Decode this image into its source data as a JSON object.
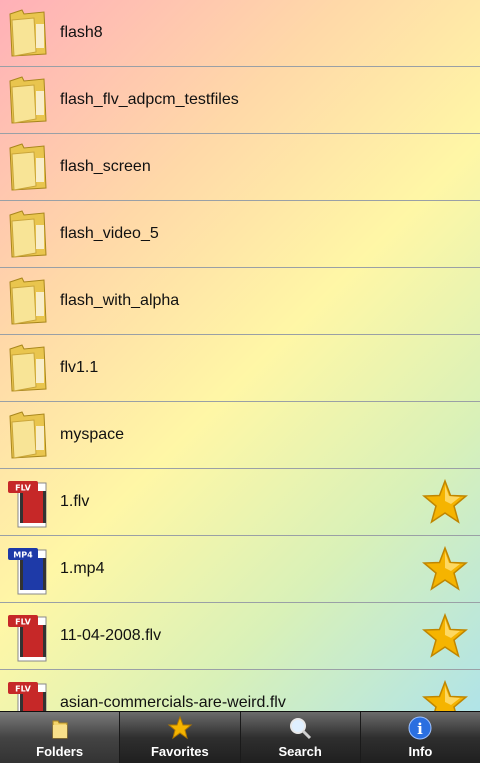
{
  "files": [
    {
      "name": "flash8",
      "type": "folder"
    },
    {
      "name": "flash_flv_adpcm_testfiles",
      "type": "folder"
    },
    {
      "name": "flash_screen",
      "type": "folder"
    },
    {
      "name": "flash_video_5",
      "type": "folder"
    },
    {
      "name": "flash_with_alpha",
      "type": "folder"
    },
    {
      "name": "flv1.1",
      "type": "folder"
    },
    {
      "name": "myspace",
      "type": "folder"
    },
    {
      "name": "1.flv",
      "type": "flv",
      "badge": "FLV",
      "favorite": true
    },
    {
      "name": "1.mp4",
      "type": "mp4",
      "badge": "MP4",
      "favorite": true
    },
    {
      "name": "11-04-2008.flv",
      "type": "flv",
      "badge": "FLV",
      "favorite": true
    },
    {
      "name": "asian-commercials-are-weird.flv",
      "type": "flv",
      "badge": "FLV",
      "favorite": true
    }
  ],
  "tabs": [
    {
      "label": "Folders",
      "icon": "folder-icon",
      "active": true
    },
    {
      "label": "Favorites",
      "icon": "star-icon",
      "active": false
    },
    {
      "label": "Search",
      "icon": "magnifier-icon",
      "active": false
    },
    {
      "label": "Info",
      "icon": "info-icon",
      "active": false
    }
  ],
  "colors": {
    "flv_badge": "#c62828",
    "mp4_badge": "#1e3aa8",
    "star": "#f5b400",
    "folder": "#f3d46a"
  }
}
